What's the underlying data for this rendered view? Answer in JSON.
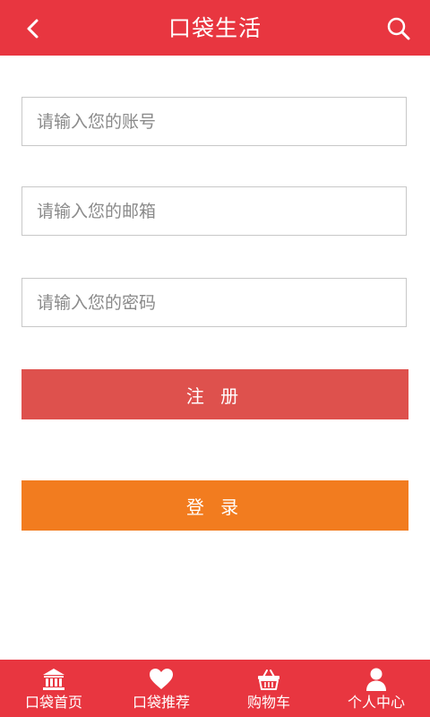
{
  "header": {
    "title": "口袋生活",
    "back_icon": "chevron-left-icon",
    "search_icon": "search-icon",
    "background": "#e83640"
  },
  "form": {
    "account_placeholder": "请输入您的账号",
    "email_placeholder": "请输入您的邮箱",
    "password_placeholder": "请输入您的密码",
    "register_label": "注 册",
    "login_label": "登 录",
    "register_color": "#de514d",
    "login_color": "#f27c1f"
  },
  "tabbar": {
    "background": "#e83640",
    "items": [
      {
        "label": "口袋首页",
        "icon": "bank-icon"
      },
      {
        "label": "口袋推荐",
        "icon": "heart-icon"
      },
      {
        "label": "购物车",
        "icon": "basket-icon"
      },
      {
        "label": "个人中心",
        "icon": "user-icon"
      }
    ]
  }
}
